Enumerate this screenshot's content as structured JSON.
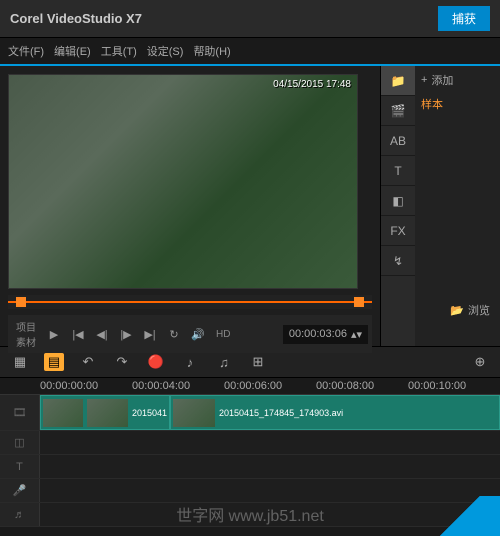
{
  "app": {
    "title": "Corel VideoStudio X7"
  },
  "tabs": {
    "capture": "捕获"
  },
  "menu": {
    "file": "文件(F)",
    "edit": "编辑(E)",
    "tools": "工具(T)",
    "settings": "设定(S)",
    "help": "帮助(H)"
  },
  "preview": {
    "timestamp": "04/15/2015 17:48"
  },
  "controls": {
    "project": "项目",
    "clip": "素材",
    "hd": "HD",
    "timecode": "00:00:03:06"
  },
  "sidebar": {
    "add": "添加",
    "sample": "样本",
    "browse": "浏览"
  },
  "ruler": {
    "t0": "00:00:00:00",
    "t1": "00:00:04:00",
    "t2": "00:00:06:00",
    "t3": "00:00:08:00",
    "t4": "00:00:10:00"
  },
  "clips": {
    "clip1": "2015041",
    "clip2": "20150415_174845_174903.avi"
  },
  "watermark": "世字网 www.jb51.net"
}
